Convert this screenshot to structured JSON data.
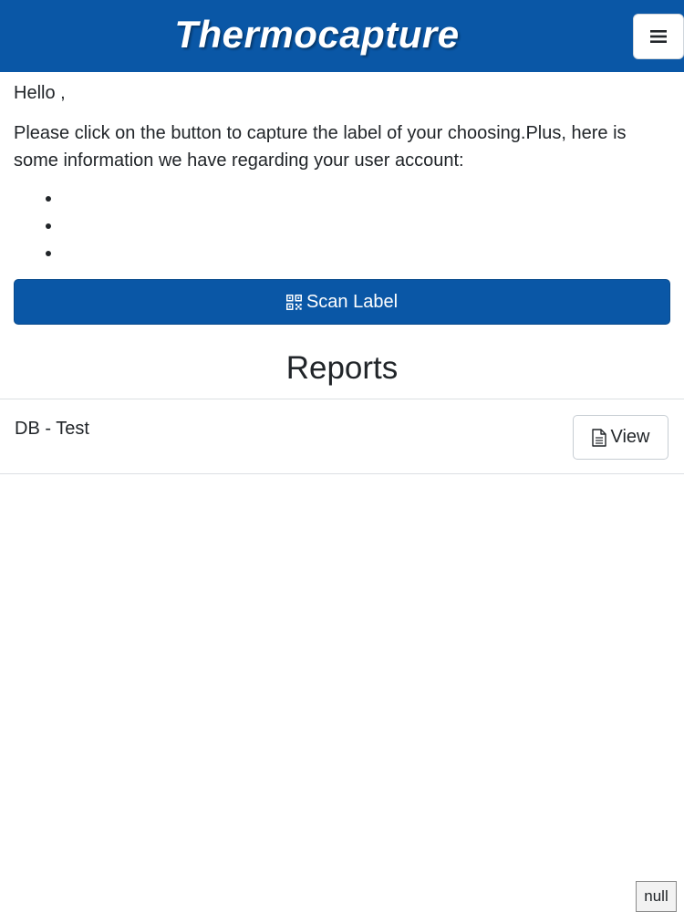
{
  "header": {
    "brand": "Thermocapture",
    "menu_icon": "hamburger-menu-icon",
    "background_color": "#0a57a6"
  },
  "main": {
    "greeting": "Hello ,",
    "intro": "Please click on the button to capture the label of your choosing.Plus, here is some information we have regarding your user account:",
    "account_items": [
      "",
      "",
      ""
    ],
    "scan_button": {
      "label": "Scan Label",
      "icon": "qrcode-icon"
    }
  },
  "reports": {
    "heading": "Reports",
    "items": [
      {
        "name": "DB - Test",
        "action_label": "View",
        "action_icon": "document-icon"
      }
    ]
  },
  "footer": {
    "badge": "null"
  },
  "colors": {
    "primary": "#0a57a6",
    "text": "#212529",
    "border": "#dcdfe3"
  }
}
